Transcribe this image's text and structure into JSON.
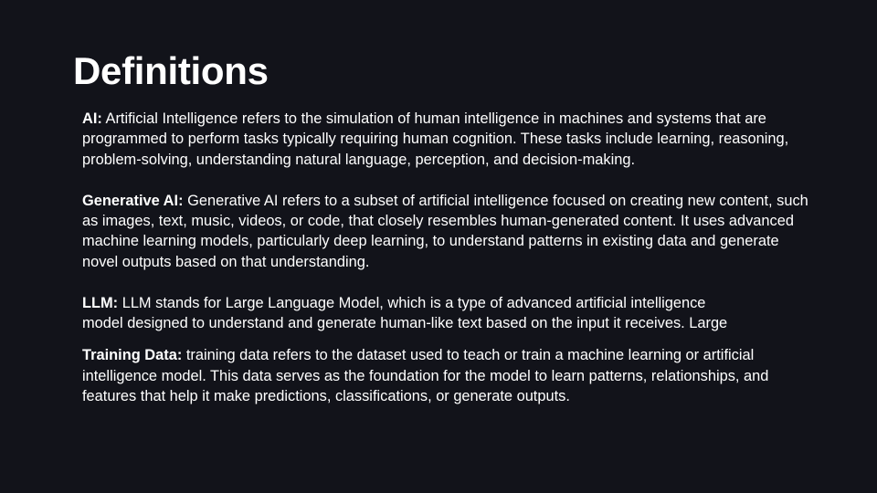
{
  "slide": {
    "title": "Definitions",
    "definitions": [
      {
        "term": "AI:",
        "text": "Artificial Intelligence refers to the simulation of human intelligence in machines and systems that are programmed to perform tasks typically requiring human cognition. These tasks include learning, reasoning, problem-solving, understanding natural language, perception, and decision-making."
      },
      {
        "term": "Generative AI:",
        "text": "Generative AI refers to a subset of artificial intelligence focused on creating new content, such as images, text, music, videos, or code, that closely resembles human-generated content. It uses advanced machine learning models, particularly deep learning, to understand patterns in existing data and generate novel outputs based on that understanding."
      },
      {
        "term": "LLM:",
        "text_line1": "LLM stands for Large Language Model, which is a type of advanced artificial intelligence",
        "text_line2": "model designed to understand and generate human-like text based on the input it receives. Large"
      },
      {
        "term": "Training Data:",
        "text": "training data refers to the dataset used to teach or train a machine learning or artificial intelligence model. This data serves as the foundation for the model to learn patterns, relationships, and features that help it make predictions, classifications, or generate outputs."
      }
    ]
  }
}
